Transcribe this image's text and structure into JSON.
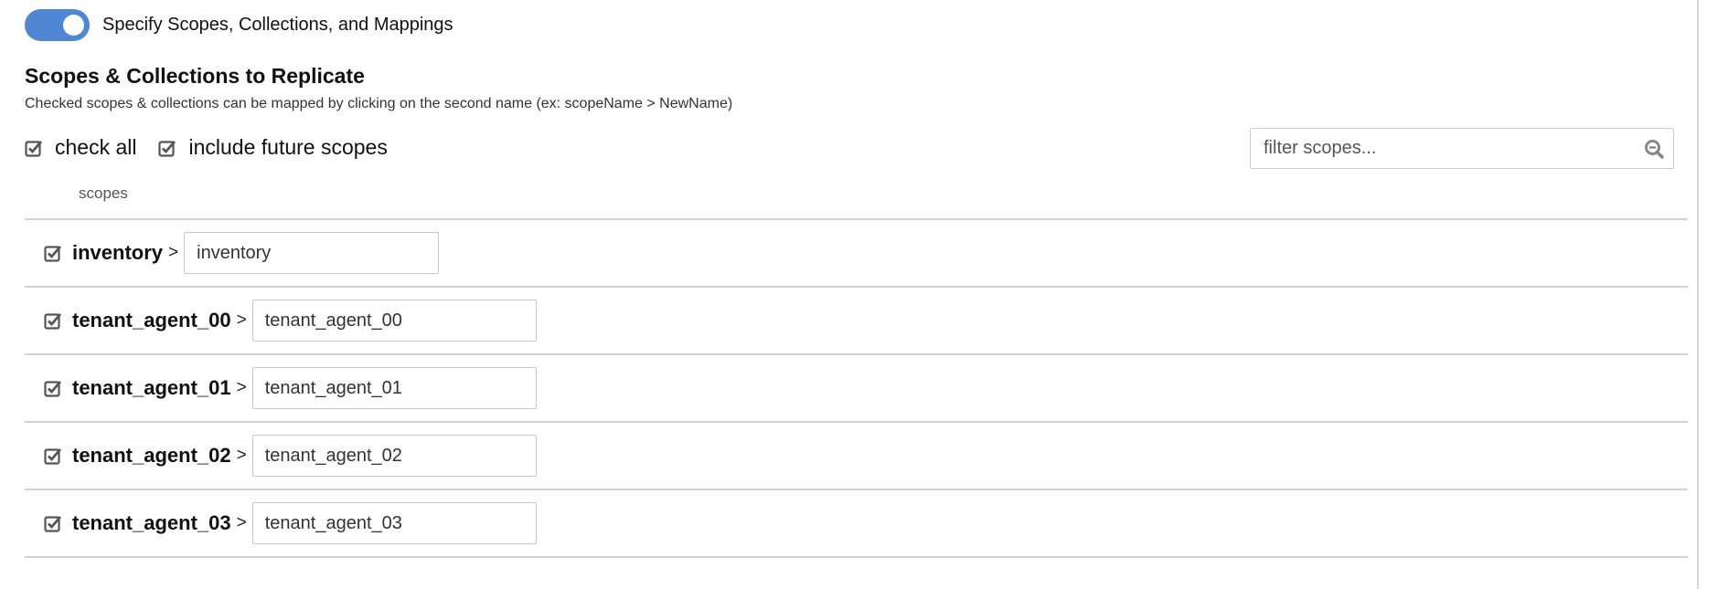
{
  "toggle": {
    "label": "Specify Scopes, Collections, and Mappings",
    "on": true,
    "color": "#5087d4"
  },
  "section": {
    "title": "Scopes & Collections to Replicate",
    "subtitle": "Checked scopes & collections can be mapped by clicking on the second name (ex: scopeName > NewName)"
  },
  "options": {
    "check_all": {
      "label": "check all",
      "checked": true
    },
    "include_future": {
      "label": "include future scopes",
      "checked": true
    }
  },
  "filter": {
    "placeholder": "filter scopes...",
    "value": "",
    "icon": "search-icon"
  },
  "column_label": "scopes",
  "scopes": [
    {
      "name": "inventory",
      "separator": ">",
      "mapped_name": "inventory",
      "checked": true
    },
    {
      "name": "tenant_agent_00",
      "separator": ">",
      "mapped_name": "tenant_agent_00",
      "checked": true
    },
    {
      "name": "tenant_agent_01",
      "separator": ">",
      "mapped_name": "tenant_agent_01",
      "checked": true
    },
    {
      "name": "tenant_agent_02",
      "separator": ">",
      "mapped_name": "tenant_agent_02",
      "checked": true
    },
    {
      "name": "tenant_agent_03",
      "separator": ">",
      "mapped_name": "tenant_agent_03",
      "checked": true
    }
  ]
}
